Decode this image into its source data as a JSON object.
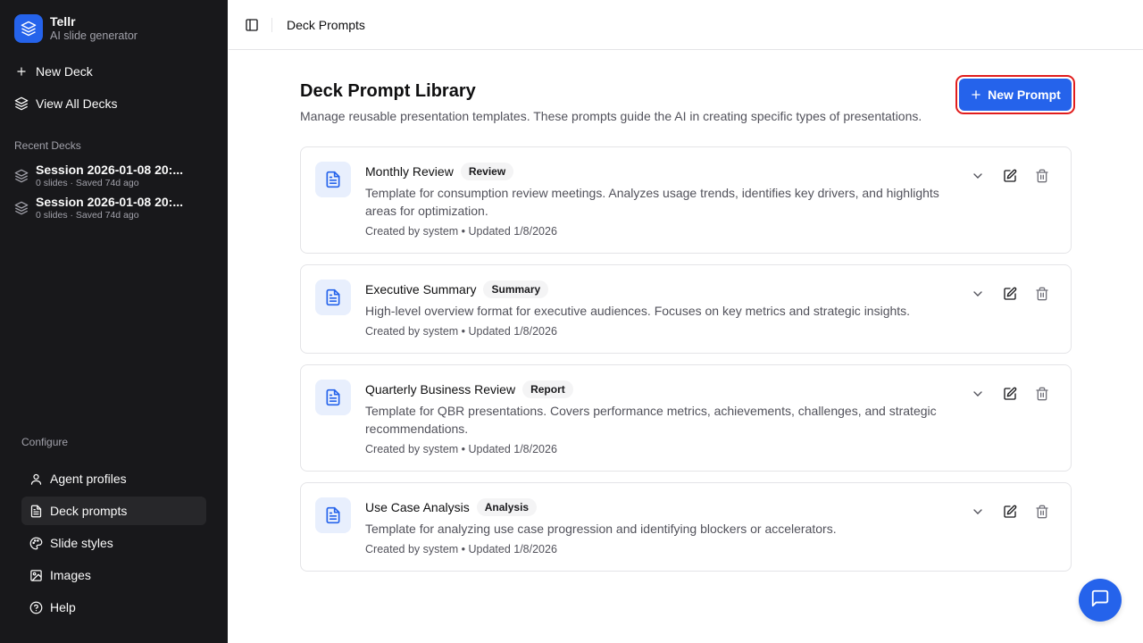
{
  "app": {
    "name": "Tellr",
    "subtitle": "AI slide generator"
  },
  "sidebar": {
    "actions": [
      {
        "label": "New Deck",
        "icon": "plus-icon"
      },
      {
        "label": "View All Decks",
        "icon": "layers-icon"
      }
    ],
    "recent_title": "Recent Decks",
    "recent": [
      {
        "title": "Session 2026-01-08 20:...",
        "meta": "0 slides · Saved 74d ago"
      },
      {
        "title": "Session 2026-01-08 20:...",
        "meta": "0 slides · Saved 74d ago"
      }
    ],
    "config_title": "Configure",
    "nav": [
      {
        "label": "Agent profiles",
        "icon": "user-icon",
        "active": false
      },
      {
        "label": "Deck prompts",
        "icon": "file-text-icon",
        "active": true
      },
      {
        "label": "Slide styles",
        "icon": "palette-icon",
        "active": false
      },
      {
        "label": "Images",
        "icon": "image-icon",
        "active": false
      },
      {
        "label": "Help",
        "icon": "help-circle-icon",
        "active": false
      }
    ]
  },
  "header": {
    "title": "Deck Prompts"
  },
  "main": {
    "title": "Deck Prompt Library",
    "description": "Manage reusable presentation templates. These prompts guide the AI in creating specific types of presentations.",
    "new_button": "New Prompt",
    "prompts": [
      {
        "name": "Monthly Review",
        "badge": "Review",
        "description": "Template for consumption review meetings. Analyzes usage trends, identifies key drivers, and highlights areas for optimization.",
        "meta": "Created by system • Updated 1/8/2026"
      },
      {
        "name": "Executive Summary",
        "badge": "Summary",
        "description": "High-level overview format for executive audiences. Focuses on key metrics and strategic insights.",
        "meta": "Created by system • Updated 1/8/2026"
      },
      {
        "name": "Quarterly Business Review",
        "badge": "Report",
        "description": "Template for QBR presentations. Covers performance metrics, achievements, challenges, and strategic recommendations.",
        "meta": "Created by system • Updated 1/8/2026"
      },
      {
        "name": "Use Case Analysis",
        "badge": "Analysis",
        "description": "Template for analyzing use case progression and identifying blockers or accelerators.",
        "meta": "Created by system • Updated 1/8/2026"
      }
    ]
  },
  "colors": {
    "accent": "#2563eb",
    "sidebar_bg": "#18181b",
    "highlight_border": "#e11d1d"
  }
}
